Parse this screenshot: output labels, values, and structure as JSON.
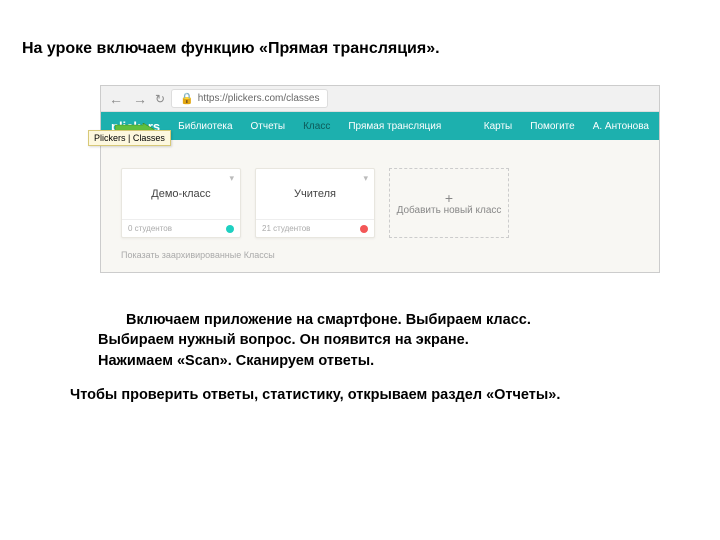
{
  "slide": {
    "heading": "На уроке включаем функцию «Прямая трансляция».",
    "paragraph1_line1": "Включаем приложение на смартфоне. Выбираем класс.",
    "paragraph1_line2": "Выбираем нужный вопрос. Он появится на экране.",
    "paragraph1_line3": "Нажимаем «Scan». Сканируем ответы.",
    "paragraph2": "Чтобы проверить ответы, статистику, открываем раздел «Отчеты»."
  },
  "browser": {
    "url": "https://plickers.com/classes",
    "tab_sticker": "Plickers | Classes"
  },
  "app": {
    "brand": "plickers",
    "nav_left": {
      "library": "Библиотека",
      "reports": "Отчеты",
      "classes": "Класс",
      "live": "Прямая трансляция"
    },
    "nav_right": {
      "cards": "Карты",
      "help": "Помогите",
      "user": "А. Антонова"
    }
  },
  "cards": {
    "demo": {
      "title": "Демо-класс",
      "footer": "0 студентов"
    },
    "teachers": {
      "title": "Учителя",
      "footer": "21 студентов"
    },
    "add": {
      "plus": "+",
      "label": "Добавить новый класс"
    }
  },
  "archived": "Показать заархивированные Классы"
}
